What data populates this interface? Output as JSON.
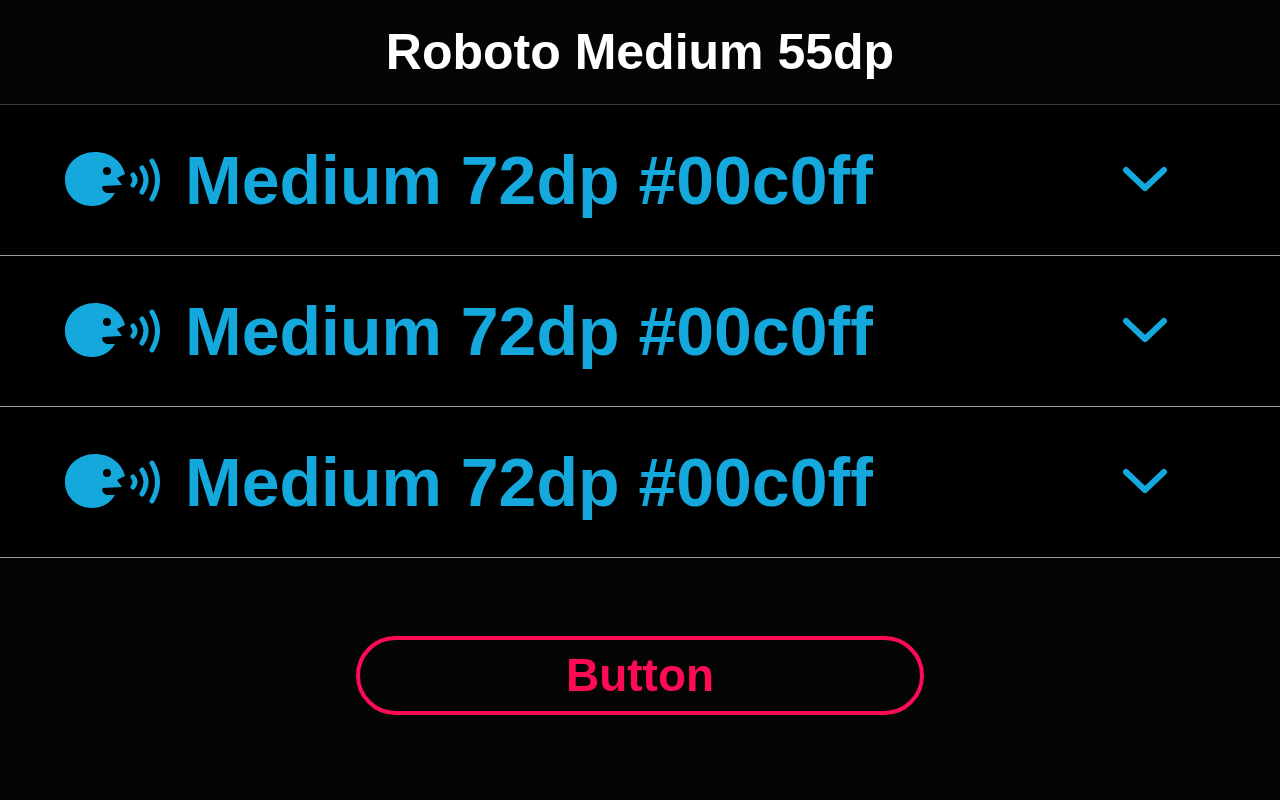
{
  "title": "Roboto Medium 55dp",
  "rows": [
    {
      "label": "Medium 72dp #00c0ff"
    },
    {
      "label": "Medium 72dp #00c0ff"
    },
    {
      "label": "Medium 72dp #00c0ff"
    }
  ],
  "button": {
    "label": "Button"
  }
}
